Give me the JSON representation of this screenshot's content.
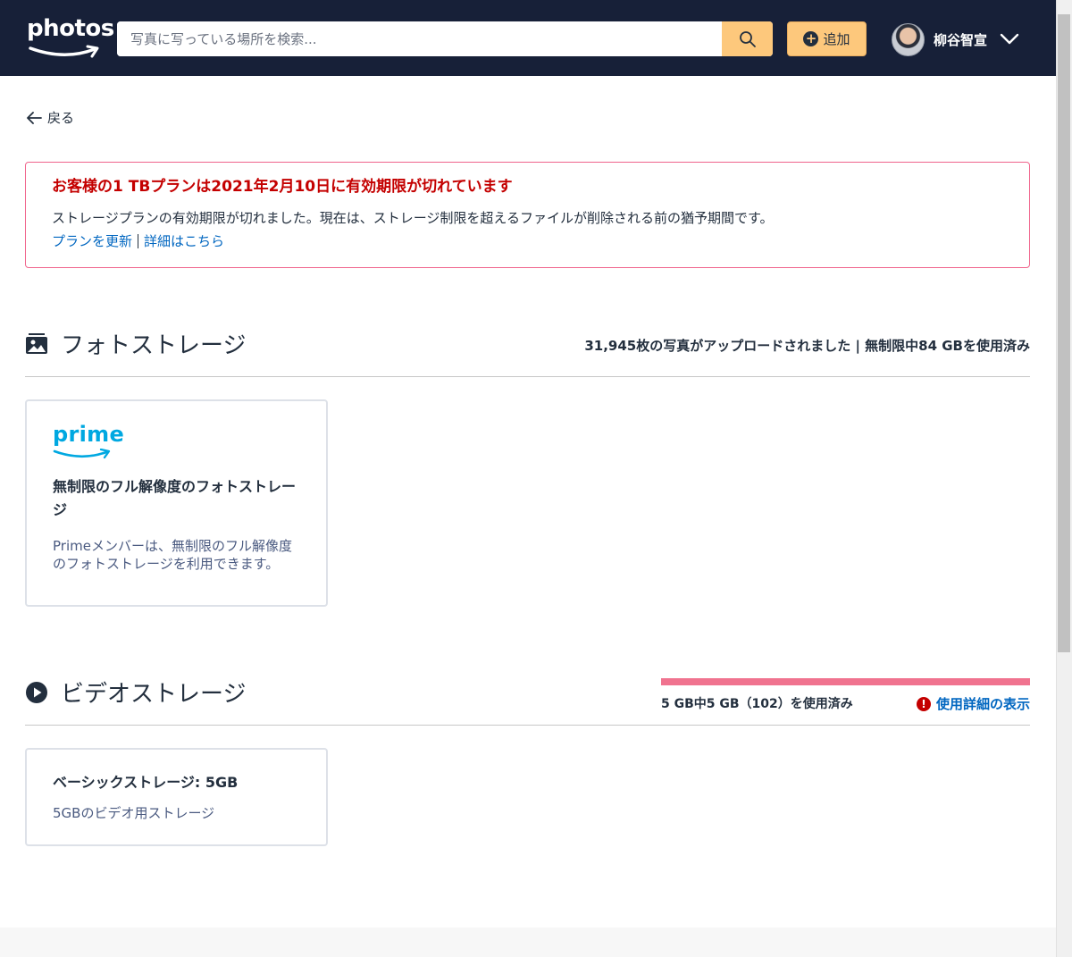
{
  "header": {
    "logo_text": "photos",
    "search_placeholder": "写真に写っている場所を検索...",
    "add_label": "追加",
    "user_name": "柳谷智宣"
  },
  "back_label": "戻る",
  "alert": {
    "title": "お客様の1 TBプランは2021年2月10日に有効期限が切れています",
    "body": "ストレージプランの有効期限が切れました。現在は、ストレージ制限を超えるファイルが削除される前の猶予期間です。",
    "link_renew": "プランを更新",
    "link_details": "詳細はこちら"
  },
  "photo_storage": {
    "title": "フォトストレージ",
    "summary": "31,945枚の写真がアップロードされました | 無制限中84 GBを使用済み",
    "card": {
      "logo": "prime",
      "title": "無制限のフル解像度のフォトストレージ",
      "desc": "Primeメンバーは、無制限のフル解像度のフォトストレージを利用できます。"
    }
  },
  "video_storage": {
    "title": "ビデオストレージ",
    "usage_fraction": 1.0,
    "usage_text": "5 GB中5 GB（102）を使用済み",
    "usage_link": "使用詳細の表示",
    "card": {
      "title": "ベーシックストレージ: 5GB",
      "desc": "5GBのビデオ用ストレージ"
    }
  },
  "colors": {
    "header_bg": "#172038",
    "accent": "#fdc87c",
    "alert_border": "#f0648c",
    "alert_title": "#c40000",
    "link": "#0066c0",
    "usage_fill": "#f0738f",
    "prime_blue": "#00a8e1"
  }
}
